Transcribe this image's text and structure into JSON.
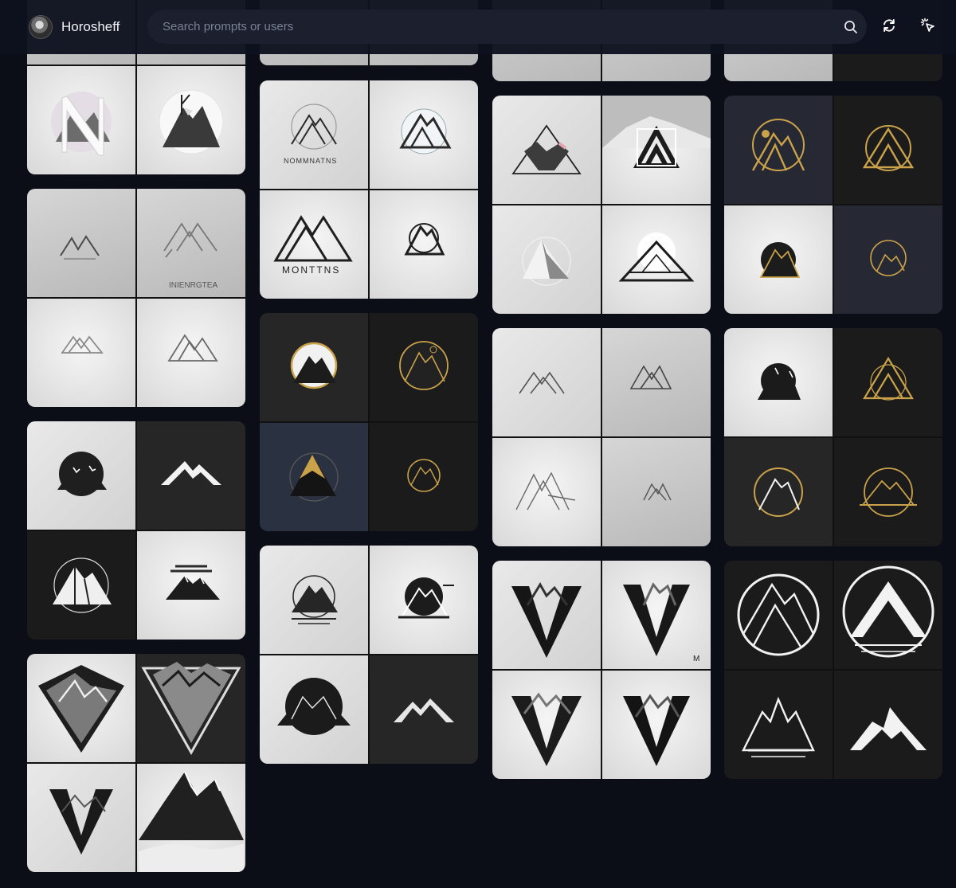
{
  "header": {
    "username": "Horosheff",
    "search_placeholder": "Search prompts or users",
    "icons": {
      "search": "search-icon",
      "refresh": "refresh-icon",
      "cursor": "cursor-click-icon",
      "avatar": "avatar"
    }
  },
  "colors": {
    "background": "#0b0d17",
    "topbar": "#0e111e",
    "search_field": "#1b1f2e",
    "placeholder": "#7b8194",
    "gold_accent": "#c9a24a"
  },
  "gallery": {
    "columns": 4,
    "tiles_per_card": 4,
    "card_texts": {
      "col2_card1_top_left": "NOMMNATNS",
      "col2_card1_bottom_left": "MONTTNS",
      "col1_card2_top_right": "INIENRGTEA",
      "col3_card4_top_right_corner": "M"
    }
  }
}
